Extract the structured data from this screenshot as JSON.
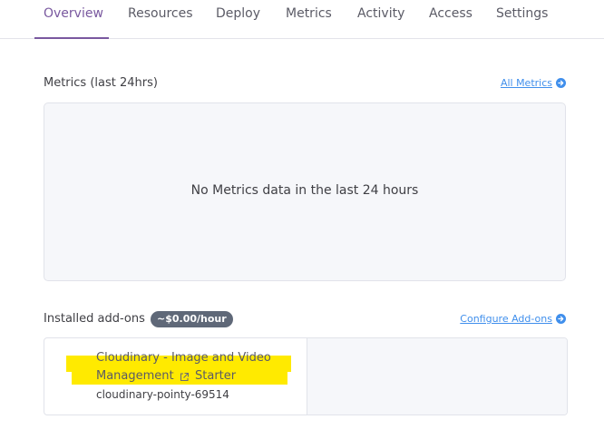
{
  "tabs": [
    {
      "label": "Overview",
      "active": true
    },
    {
      "label": "Resources",
      "active": false
    },
    {
      "label": "Deploy",
      "active": false
    },
    {
      "label": "Metrics",
      "active": false
    },
    {
      "label": "Activity",
      "active": false
    },
    {
      "label": "Access",
      "active": false
    },
    {
      "label": "Settings",
      "active": false
    }
  ],
  "metrics": {
    "title": "Metrics (last 24hrs)",
    "link_label": "All Metrics",
    "empty_message": "No Metrics data in the last 24 hours"
  },
  "addons": {
    "title": "Installed add-ons",
    "cost_badge": "~$0.00/hour",
    "link_label": "Configure Add-ons",
    "items": [
      {
        "name_line1": "Cloudinary - Image and Video",
        "name_line2": "Management",
        "plan": "Starter",
        "instance": "cloudinary-pointy-69514",
        "highlighted": true
      }
    ]
  },
  "colors": {
    "accent": "#79589f",
    "link": "#408fec",
    "highlight": "#ffea00",
    "badge_bg": "#5f6878",
    "panel_bg": "#f6f7fa"
  },
  "icons": {
    "link_arrow": "circle-arrow-right-icon",
    "external": "external-link-icon"
  }
}
